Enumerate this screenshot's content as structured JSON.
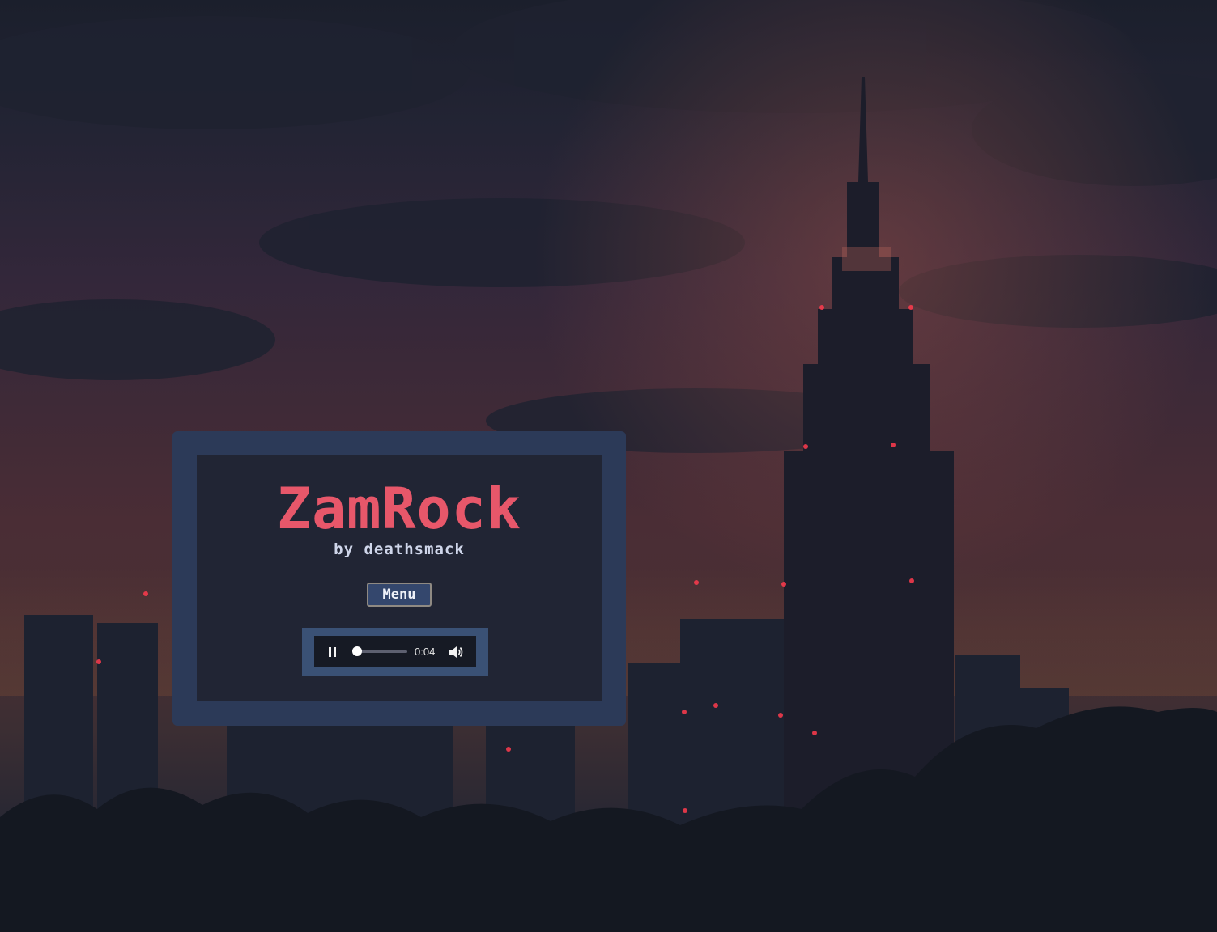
{
  "game": {
    "title": "ZamRock",
    "subtitle": "by deathsmack"
  },
  "menu": {
    "button_label": "Menu"
  },
  "audio_player": {
    "state": "playing",
    "progress_fraction": 0.04,
    "time_display": "0:04",
    "control_icons": [
      "pause-icon",
      "volume-icon"
    ]
  },
  "colors": {
    "title": "#e7576a",
    "subtitle": "#cfd6ea",
    "panel_frame": "#2c3a58",
    "menu_button_bg": "#34476d",
    "player_frame": "#3a5175"
  }
}
